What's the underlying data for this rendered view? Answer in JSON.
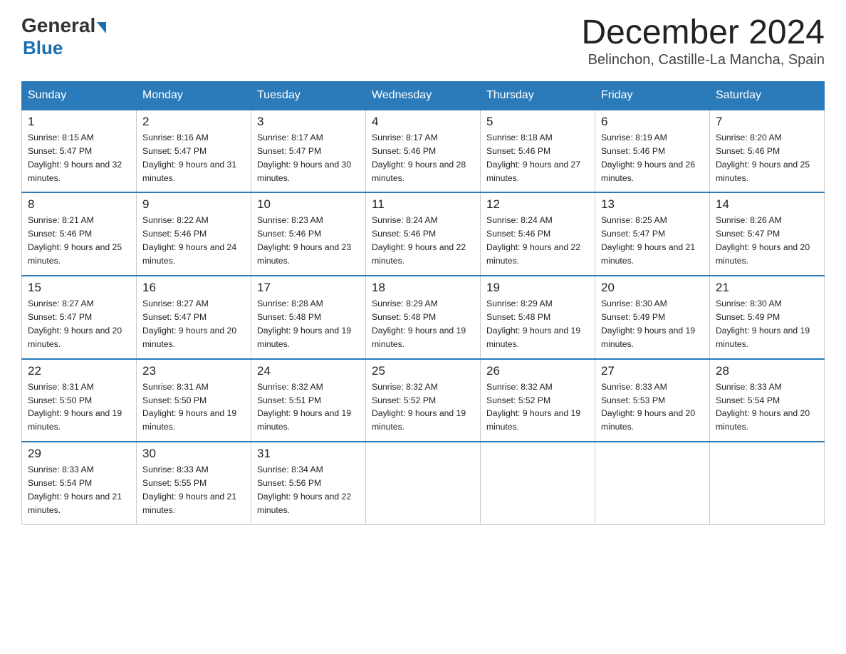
{
  "header": {
    "logo_general": "General",
    "logo_blue": "Blue",
    "month_title": "December 2024",
    "location": "Belinchon, Castille-La Mancha, Spain"
  },
  "weekdays": [
    "Sunday",
    "Monday",
    "Tuesday",
    "Wednesday",
    "Thursday",
    "Friday",
    "Saturday"
  ],
  "weeks": [
    [
      {
        "day": "1",
        "sunrise": "8:15 AM",
        "sunset": "5:47 PM",
        "daylight": "9 hours and 32 minutes."
      },
      {
        "day": "2",
        "sunrise": "8:16 AM",
        "sunset": "5:47 PM",
        "daylight": "9 hours and 31 minutes."
      },
      {
        "day": "3",
        "sunrise": "8:17 AM",
        "sunset": "5:47 PM",
        "daylight": "9 hours and 30 minutes."
      },
      {
        "day": "4",
        "sunrise": "8:17 AM",
        "sunset": "5:46 PM",
        "daylight": "9 hours and 28 minutes."
      },
      {
        "day": "5",
        "sunrise": "8:18 AM",
        "sunset": "5:46 PM",
        "daylight": "9 hours and 27 minutes."
      },
      {
        "day": "6",
        "sunrise": "8:19 AM",
        "sunset": "5:46 PM",
        "daylight": "9 hours and 26 minutes."
      },
      {
        "day": "7",
        "sunrise": "8:20 AM",
        "sunset": "5:46 PM",
        "daylight": "9 hours and 25 minutes."
      }
    ],
    [
      {
        "day": "8",
        "sunrise": "8:21 AM",
        "sunset": "5:46 PM",
        "daylight": "9 hours and 25 minutes."
      },
      {
        "day": "9",
        "sunrise": "8:22 AM",
        "sunset": "5:46 PM",
        "daylight": "9 hours and 24 minutes."
      },
      {
        "day": "10",
        "sunrise": "8:23 AM",
        "sunset": "5:46 PM",
        "daylight": "9 hours and 23 minutes."
      },
      {
        "day": "11",
        "sunrise": "8:24 AM",
        "sunset": "5:46 PM",
        "daylight": "9 hours and 22 minutes."
      },
      {
        "day": "12",
        "sunrise": "8:24 AM",
        "sunset": "5:46 PM",
        "daylight": "9 hours and 22 minutes."
      },
      {
        "day": "13",
        "sunrise": "8:25 AM",
        "sunset": "5:47 PM",
        "daylight": "9 hours and 21 minutes."
      },
      {
        "day": "14",
        "sunrise": "8:26 AM",
        "sunset": "5:47 PM",
        "daylight": "9 hours and 20 minutes."
      }
    ],
    [
      {
        "day": "15",
        "sunrise": "8:27 AM",
        "sunset": "5:47 PM",
        "daylight": "9 hours and 20 minutes."
      },
      {
        "day": "16",
        "sunrise": "8:27 AM",
        "sunset": "5:47 PM",
        "daylight": "9 hours and 20 minutes."
      },
      {
        "day": "17",
        "sunrise": "8:28 AM",
        "sunset": "5:48 PM",
        "daylight": "9 hours and 19 minutes."
      },
      {
        "day": "18",
        "sunrise": "8:29 AM",
        "sunset": "5:48 PM",
        "daylight": "9 hours and 19 minutes."
      },
      {
        "day": "19",
        "sunrise": "8:29 AM",
        "sunset": "5:48 PM",
        "daylight": "9 hours and 19 minutes."
      },
      {
        "day": "20",
        "sunrise": "8:30 AM",
        "sunset": "5:49 PM",
        "daylight": "9 hours and 19 minutes."
      },
      {
        "day": "21",
        "sunrise": "8:30 AM",
        "sunset": "5:49 PM",
        "daylight": "9 hours and 19 minutes."
      }
    ],
    [
      {
        "day": "22",
        "sunrise": "8:31 AM",
        "sunset": "5:50 PM",
        "daylight": "9 hours and 19 minutes."
      },
      {
        "day": "23",
        "sunrise": "8:31 AM",
        "sunset": "5:50 PM",
        "daylight": "9 hours and 19 minutes."
      },
      {
        "day": "24",
        "sunrise": "8:32 AM",
        "sunset": "5:51 PM",
        "daylight": "9 hours and 19 minutes."
      },
      {
        "day": "25",
        "sunrise": "8:32 AM",
        "sunset": "5:52 PM",
        "daylight": "9 hours and 19 minutes."
      },
      {
        "day": "26",
        "sunrise": "8:32 AM",
        "sunset": "5:52 PM",
        "daylight": "9 hours and 19 minutes."
      },
      {
        "day": "27",
        "sunrise": "8:33 AM",
        "sunset": "5:53 PM",
        "daylight": "9 hours and 20 minutes."
      },
      {
        "day": "28",
        "sunrise": "8:33 AM",
        "sunset": "5:54 PM",
        "daylight": "9 hours and 20 minutes."
      }
    ],
    [
      {
        "day": "29",
        "sunrise": "8:33 AM",
        "sunset": "5:54 PM",
        "daylight": "9 hours and 21 minutes."
      },
      {
        "day": "30",
        "sunrise": "8:33 AM",
        "sunset": "5:55 PM",
        "daylight": "9 hours and 21 minutes."
      },
      {
        "day": "31",
        "sunrise": "8:34 AM",
        "sunset": "5:56 PM",
        "daylight": "9 hours and 22 minutes."
      },
      null,
      null,
      null,
      null
    ]
  ]
}
